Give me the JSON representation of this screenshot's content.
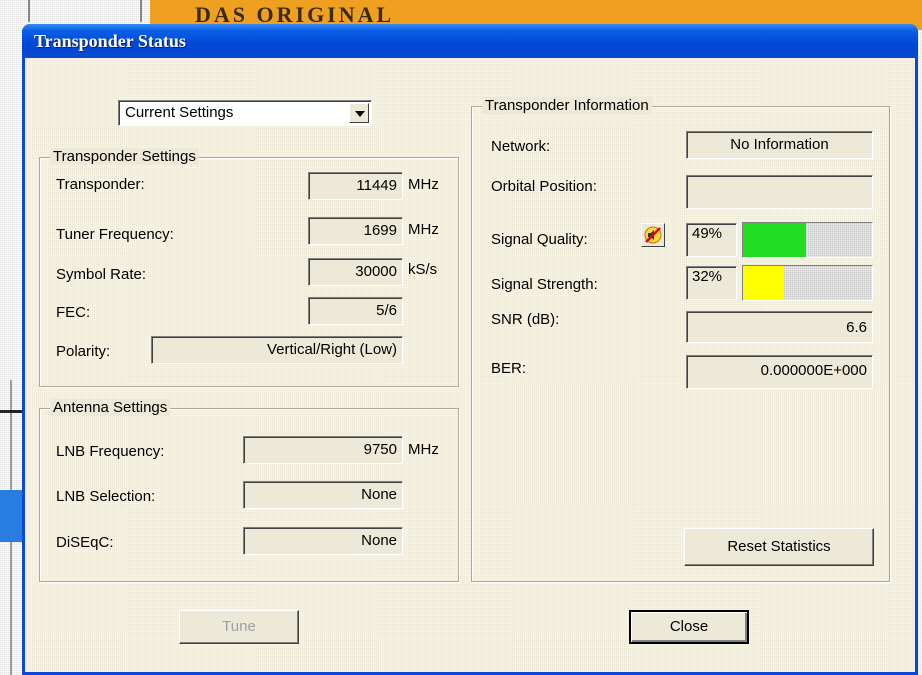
{
  "background": {
    "banner_text": "DAS ORIGINAL"
  },
  "dialog": {
    "title": "Transponder Status",
    "view_select": {
      "value": "Current Settings"
    },
    "transponder_settings": {
      "legend": "Transponder Settings",
      "transponder": {
        "label": "Transponder:",
        "value": "11449",
        "unit": "MHz"
      },
      "tuner_frequency": {
        "label": "Tuner Frequency:",
        "value": "1699",
        "unit": "MHz"
      },
      "symbol_rate": {
        "label": "Symbol Rate:",
        "value": "30000",
        "unit": "kS/s"
      },
      "fec": {
        "label": "FEC:",
        "value": "5/6"
      },
      "polarity": {
        "label": "Polarity:",
        "value": "Vertical/Right (Low)"
      }
    },
    "antenna_settings": {
      "legend": "Antenna Settings",
      "lnb_frequency": {
        "label": "LNB Frequency:",
        "value": "9750",
        "unit": "MHz"
      },
      "lnb_selection": {
        "label": "LNB Selection:",
        "value": "None"
      },
      "diseqc": {
        "label": "DiSEqC:",
        "value": "None"
      }
    },
    "transponder_information": {
      "legend": "Transponder Information",
      "network": {
        "label": "Network:",
        "value": "No Information"
      },
      "orbital_position": {
        "label": "Orbital Position:",
        "value": ""
      },
      "signal_quality": {
        "label": "Signal Quality:",
        "value": "49%",
        "level": 0.49,
        "color": "#22dd22"
      },
      "signal_strength": {
        "label": "Signal Strength:",
        "value": "32%",
        "level": 0.32,
        "color": "#ffff00"
      },
      "snr": {
        "label": "SNR (dB):",
        "value": "6.6"
      },
      "ber": {
        "label": "BER:",
        "value": "0.000000E+000"
      },
      "reset_button": "Reset Statistics"
    },
    "buttons": {
      "tune": "Tune",
      "close": "Close"
    }
  }
}
